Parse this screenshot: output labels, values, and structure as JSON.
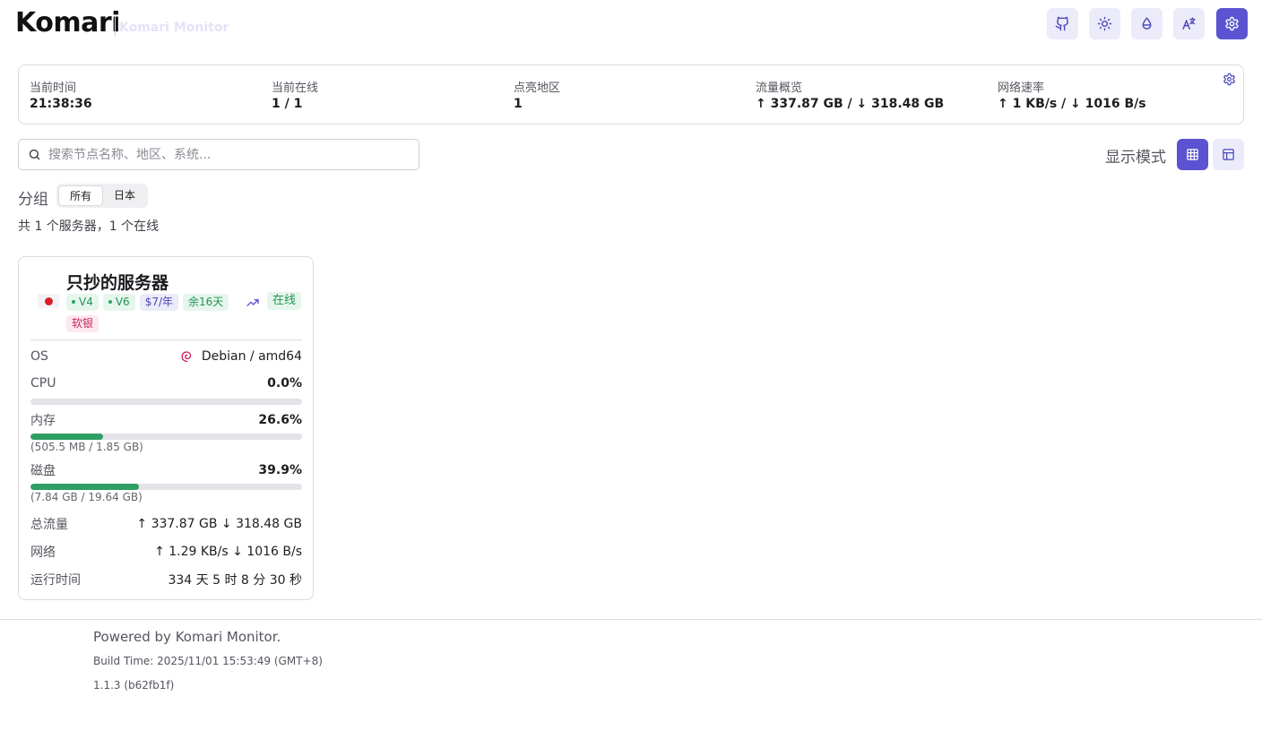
{
  "header": {
    "title": "Komari",
    "subtitle": "Komari Monitor",
    "buttons": [
      "github-icon",
      "sun-icon",
      "droplet-icon",
      "translate-icon",
      "settings-icon"
    ]
  },
  "stats": {
    "time_label": "当前时间",
    "time_value": "21:38:36",
    "online_label": "当前在线",
    "online_value": "1 / 1",
    "regions_label": "点亮地区",
    "regions_value": "1",
    "traffic_label": "流量概览",
    "traffic_value": "↑ 337.87 GB / ↓ 318.48 GB",
    "speed_label": "网络速率",
    "speed_value": "↑ 1 KB/s / ↓ 1016 B/s"
  },
  "search": {
    "placeholder": "搜索节点名称、地区、系统..."
  },
  "display_mode": {
    "label": "显示模式",
    "active": "grid"
  },
  "group": {
    "label": "分组",
    "tabs": [
      {
        "label": "所有",
        "active": true
      },
      {
        "label": "日本",
        "active": false
      }
    ]
  },
  "summary": "共 1 个服务器，1 个在线",
  "server": {
    "name": "只抄的服务器",
    "flag": "japan-flag",
    "tags": [
      "V4",
      "V6",
      "$7/年",
      "余16天",
      "软银"
    ],
    "status": "在线",
    "os_label": "OS",
    "os_value": "Debian / amd64",
    "cpu_label": "CPU",
    "cpu_value": "0.0%",
    "cpu_percent": 0.0,
    "mem_label": "内存",
    "mem_value": "26.6%",
    "mem_percent": 26.6,
    "mem_detail": "(505.5 MB / 1.85 GB)",
    "disk_label": "磁盘",
    "disk_value": "39.9%",
    "disk_percent": 39.9,
    "disk_detail": "(7.84 GB / 19.64 GB)",
    "traffic_label": "总流量",
    "traffic_value": "↑ 337.87 GB ↓ 318.48 GB",
    "net_label": "网络",
    "net_value": "↑ 1.29 KB/s ↓ 1016 B/s",
    "uptime_label": "运行时间",
    "uptime_value": "334 天 5 时 8 分 30 秒"
  },
  "footer": {
    "powered": "Powered by Komari Monitor.",
    "build": "Build Time: 2025/11/01 15:53:49 (GMT+8)",
    "version": "1.1.3 (b62fb1f)"
  },
  "colors": {
    "accent": "#5b53d1",
    "accent_soft": "#ecebfa",
    "success": "#2f9e63"
  }
}
